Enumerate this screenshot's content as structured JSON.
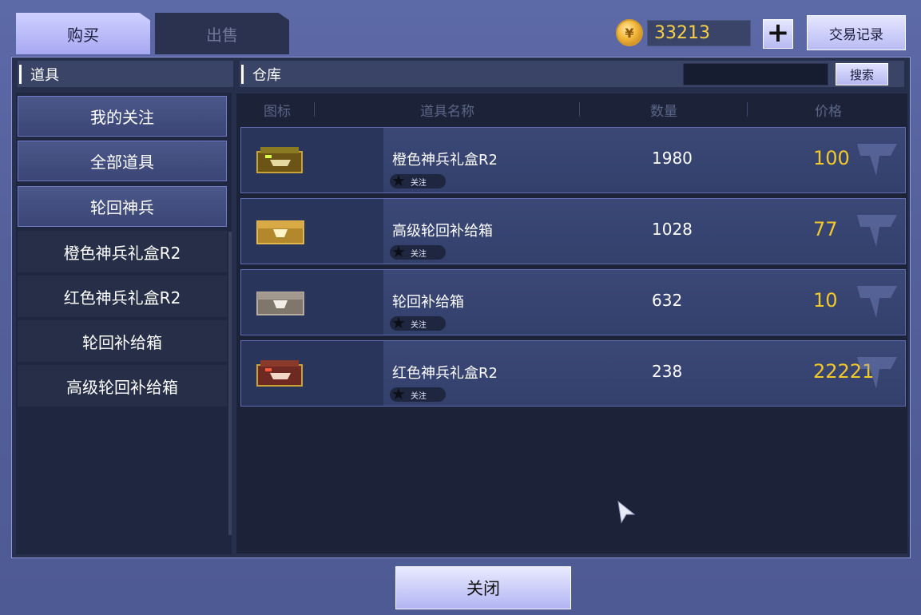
{
  "tabs": {
    "buy_label": "购买",
    "sell_label": "出售"
  },
  "currency": {
    "amount": "33213",
    "add_label": "+",
    "history_label": "交易记录"
  },
  "left_panel": {
    "header": "道具",
    "categories": [
      "我的关注",
      "全部道具",
      "轮回神兵"
    ],
    "subitems": [
      "橙色神兵礼盒R2",
      "红色神兵礼盒R2",
      "轮回补给箱",
      "高级轮回补给箱"
    ]
  },
  "right_panel": {
    "header": "仓库",
    "search_value": "",
    "search_button": "搜索",
    "columns": [
      "图标",
      "道具名称",
      "数量",
      "价格"
    ],
    "rows": [
      {
        "name": "橙色神兵礼盒R2",
        "follow": "关注",
        "qty": "1980",
        "price": "100"
      },
      {
        "name": "高级轮回补给箱",
        "follow": "关注",
        "qty": "1028",
        "price": "77"
      },
      {
        "name": "轮回补给箱",
        "follow": "关注",
        "qty": "632",
        "price": "10"
      },
      {
        "name": "红色神兵礼盒R2",
        "follow": "关注",
        "qty": "238",
        "price": "22221"
      }
    ]
  },
  "footer": {
    "close_label": "关闭"
  },
  "colors": {
    "accent": "#b6b8f0",
    "price": "#f3c92a",
    "panel": "#1c2338"
  }
}
